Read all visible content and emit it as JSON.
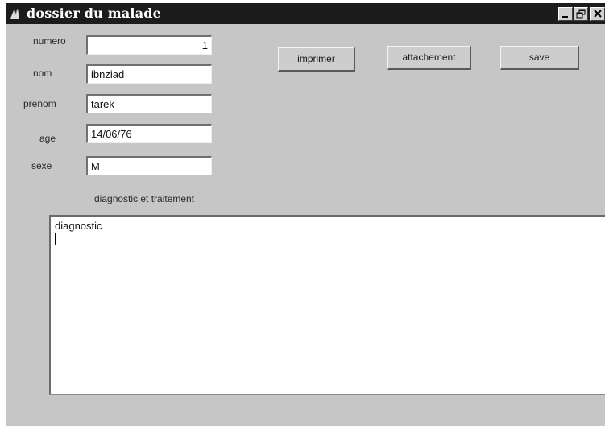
{
  "window": {
    "title": "dossier du malade",
    "controls": {
      "minimize_icon": "minimize-icon",
      "maximize_icon": "restore-icon",
      "close_icon": "close-icon"
    }
  },
  "form": {
    "numero": {
      "label": "numero",
      "value": "1"
    },
    "nom": {
      "label": "nom",
      "value": "ibnziad"
    },
    "prenom": {
      "label": "prenom",
      "value": "tarek"
    },
    "age": {
      "label": "age",
      "value": "14/06/76"
    },
    "sexe": {
      "label": "sexe",
      "value": "M"
    }
  },
  "toolbar": {
    "imprimer_label": "imprimer",
    "attachement_label": "attachement",
    "save_label": "save"
  },
  "notes": {
    "section_label": "diagnostic et traitement",
    "content": "diagnostic"
  },
  "colors": {
    "title_bar": "#1c1c1c",
    "window_bg": "#c6c6c6",
    "field_bg": "#ffffff"
  }
}
